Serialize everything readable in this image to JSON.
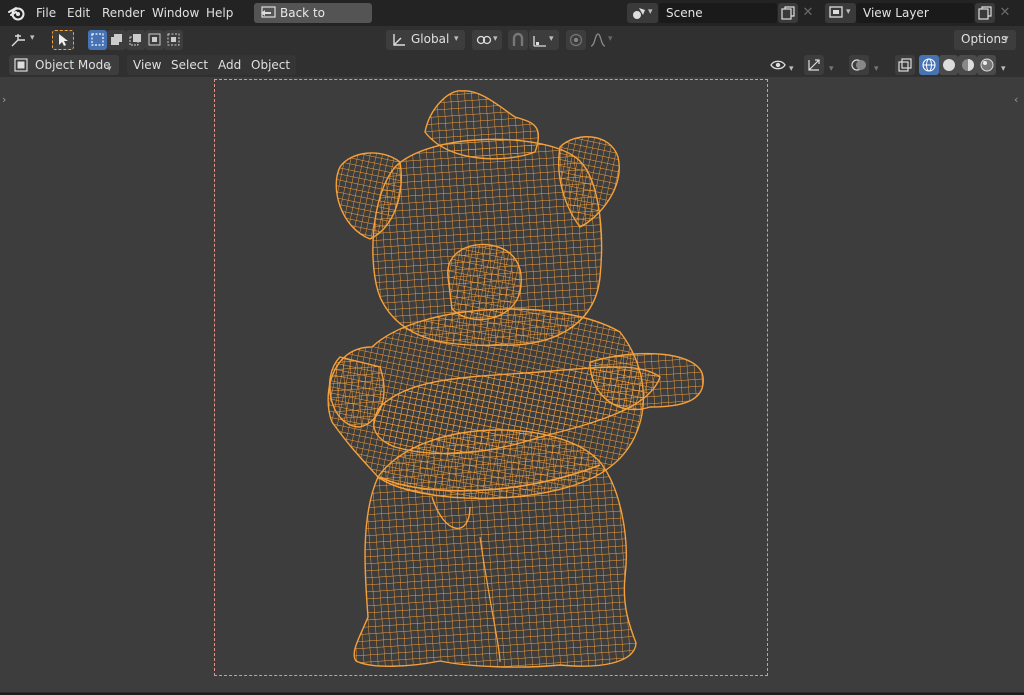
{
  "menu": {
    "items": [
      "File",
      "Edit",
      "Render",
      "Window",
      "Help"
    ],
    "back_label": "Back to Previous"
  },
  "scene": {
    "name": "Scene"
  },
  "view_layer": {
    "name": "View Layer"
  },
  "toolbar": {
    "transform_orientation": "Global",
    "options_label": "Options"
  },
  "header": {
    "mode": "Object Mode",
    "menus": [
      "View",
      "Select",
      "Add",
      "Object"
    ]
  },
  "viewport": {
    "wire_color": "#f5a03a",
    "background": "#3d3d3d",
    "camera_border": "#e8908a"
  }
}
